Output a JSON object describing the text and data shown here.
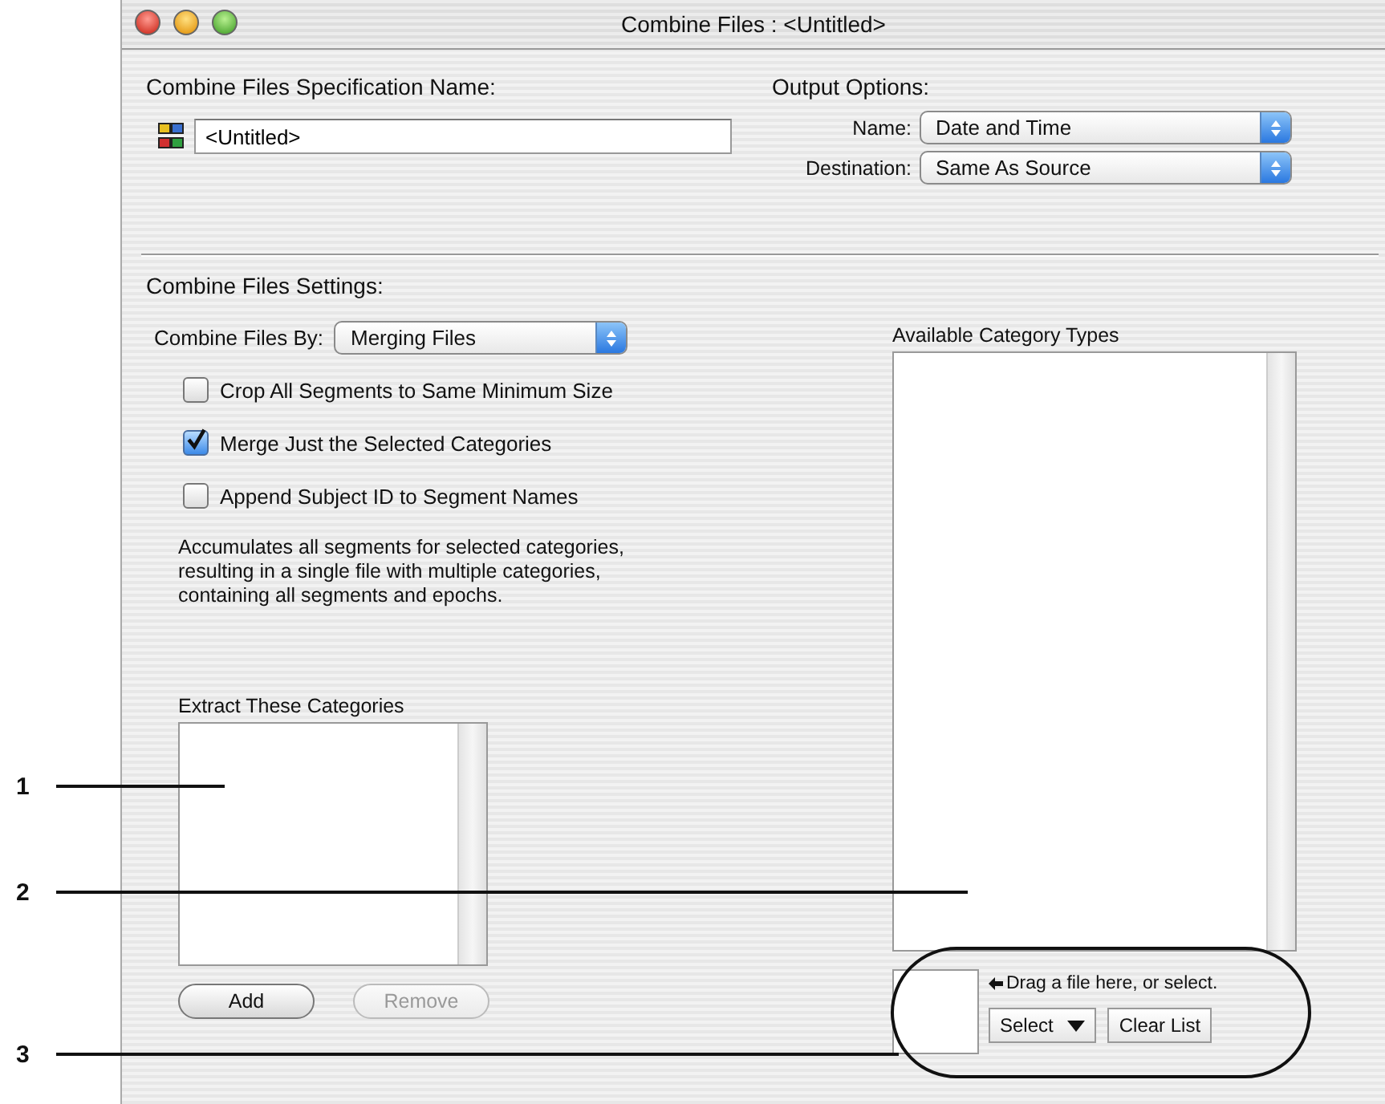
{
  "window": {
    "title": "Combine Files : <Untitled>"
  },
  "specification": {
    "label": "Combine Files Specification Name:",
    "value": "<Untitled>"
  },
  "output_options": {
    "heading": "Output Options:",
    "fields": [
      {
        "label": "Name:",
        "value": "Date and Time"
      },
      {
        "label": "Destination:",
        "value": "Same As Source"
      }
    ]
  },
  "settings": {
    "heading": "Combine Files Settings:",
    "combine_by": {
      "label": "Combine Files By:",
      "value": "Merging Files"
    },
    "options": [
      {
        "label": "Crop All Segments to Same Minimum Size",
        "checked": false
      },
      {
        "label": "Merge Just the Selected Categories",
        "checked": true
      },
      {
        "label": "Append Subject ID to Segment Names",
        "checked": false
      }
    ],
    "description": "Accumulates all segments for selected categories,\nresulting in a single file with multiple categories,\ncontaining all segments and epochs."
  },
  "extract_list": {
    "label": "Extract These Categories",
    "buttons": [
      {
        "label": "Add",
        "disabled": false
      },
      {
        "label": "Remove",
        "disabled": true
      }
    ]
  },
  "available_list": {
    "label": "Available Category Types"
  },
  "file_drop": {
    "hint": "Drag a file here, or select.",
    "select_button": "Select",
    "clear_button": "Clear List"
  },
  "callouts": [
    {
      "number": "1"
    },
    {
      "number": "2"
    },
    {
      "number": "3"
    }
  ]
}
